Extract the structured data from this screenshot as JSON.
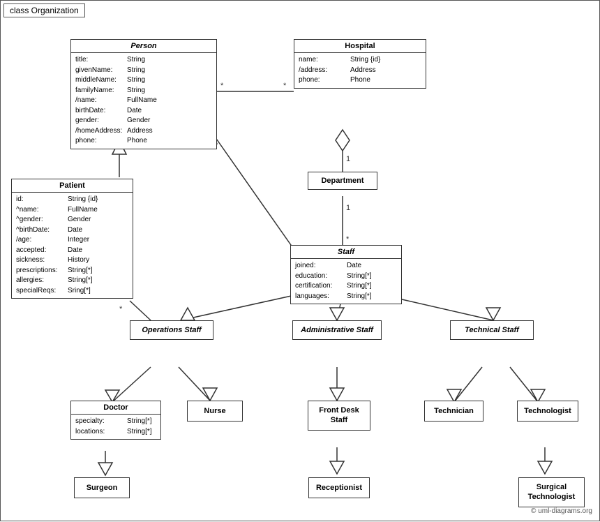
{
  "title": "class Organization",
  "copyright": "© uml-diagrams.org",
  "classes": {
    "person": {
      "name": "Person",
      "italic": true,
      "attrs": [
        {
          "name": "title:",
          "type": "String"
        },
        {
          "name": "givenName:",
          "type": "String"
        },
        {
          "name": "middleName:",
          "type": "String"
        },
        {
          "name": "familyName:",
          "type": "String"
        },
        {
          "name": "/name:",
          "type": "FullName"
        },
        {
          "name": "birthDate:",
          "type": "Date"
        },
        {
          "name": "gender:",
          "type": "Gender"
        },
        {
          "name": "/homeAddress:",
          "type": "Address"
        },
        {
          "name": "phone:",
          "type": "Phone"
        }
      ]
    },
    "hospital": {
      "name": "Hospital",
      "attrs": [
        {
          "name": "name:",
          "type": "String {id}"
        },
        {
          "name": "/address:",
          "type": "Address"
        },
        {
          "name": "phone:",
          "type": "Phone"
        }
      ]
    },
    "patient": {
      "name": "Patient",
      "attrs": [
        {
          "name": "id:",
          "type": "String {id}"
        },
        {
          "name": "^name:",
          "type": "FullName"
        },
        {
          "name": "^gender:",
          "type": "Gender"
        },
        {
          "name": "^birthDate:",
          "type": "Date"
        },
        {
          "name": "/age:",
          "type": "Integer"
        },
        {
          "name": "accepted:",
          "type": "Date"
        },
        {
          "name": "sickness:",
          "type": "History"
        },
        {
          "name": "prescriptions:",
          "type": "String[*]"
        },
        {
          "name": "allergies:",
          "type": "String[*]"
        },
        {
          "name": "specialReqs:",
          "type": "Sring[*]"
        }
      ]
    },
    "department": {
      "name": "Department"
    },
    "staff": {
      "name": "Staff",
      "italic": true,
      "attrs": [
        {
          "name": "joined:",
          "type": "Date"
        },
        {
          "name": "education:",
          "type": "String[*]"
        },
        {
          "name": "certification:",
          "type": "String[*]"
        },
        {
          "name": "languages:",
          "type": "String[*]"
        }
      ]
    },
    "operations_staff": {
      "name": "Operations Staff",
      "italic": true
    },
    "administrative_staff": {
      "name": "Administrative Staff",
      "italic": true
    },
    "technical_staff": {
      "name": "Technical Staff",
      "italic": true
    },
    "doctor": {
      "name": "Doctor",
      "attrs": [
        {
          "name": "specialty:",
          "type": "String[*]"
        },
        {
          "name": "locations:",
          "type": "String[*]"
        }
      ]
    },
    "nurse": {
      "name": "Nurse"
    },
    "front_desk_staff": {
      "name": "Front Desk Staff"
    },
    "technician": {
      "name": "Technician"
    },
    "technologist": {
      "name": "Technologist"
    },
    "surgeon": {
      "name": "Surgeon"
    },
    "receptionist": {
      "name": "Receptionist"
    },
    "surgical_technologist": {
      "name": "Surgical Technologist"
    }
  }
}
